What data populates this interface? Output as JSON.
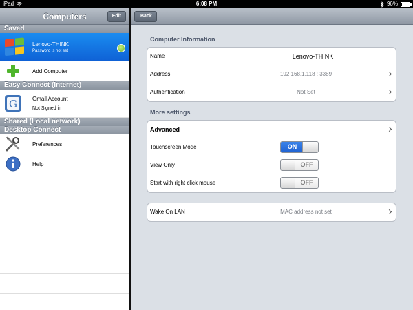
{
  "status": {
    "device": "iPad",
    "time": "6:08 PM",
    "battery": "96%",
    "battery_level": 0.96
  },
  "left": {
    "title": "Computers",
    "edit_label": "Edit",
    "sections": {
      "saved": "Saved",
      "easy_connect": "Easy Connect (Internet)",
      "shared": "Shared (Local network)",
      "desktop_connect": "Desktop Connect"
    },
    "saved_items": [
      {
        "name": "Lenovo-THINK",
        "sub": "Password is not set"
      }
    ],
    "add_computer": "Add Computer",
    "gmail": {
      "name": "Gmail Account",
      "sub": "Not Signed in"
    },
    "preferences": "Preferences",
    "help": "Help"
  },
  "right": {
    "back_label": "Back",
    "computer_info_title": "Computer Information",
    "info_rows": [
      {
        "label": "Name",
        "value": "Lenovo-THINK"
      },
      {
        "label": "Address",
        "value": "192.168.1.118 : 3389"
      },
      {
        "label": "Authentication",
        "value": "Not Set"
      }
    ],
    "more_settings_title": "More settings",
    "advanced_label": "Advanced",
    "toggles": [
      {
        "label": "Touchscreen Mode",
        "state": "ON"
      },
      {
        "label": "View Only",
        "state": "OFF"
      },
      {
        "label": "Start with right click mouse",
        "state": "OFF"
      }
    ],
    "wake_on_lan": {
      "label": "Wake On LAN",
      "value": "MAC address not set"
    }
  },
  "colors": {
    "selection": "#1a8cf0",
    "toggle_on": "#2f74e0",
    "panel_bg": "#dbe0e6"
  },
  "icons": [
    "wifi-icon",
    "bluetooth-icon",
    "battery-icon",
    "windows-logo-icon",
    "sync-status-icon",
    "add-icon",
    "google-icon",
    "tools-icon",
    "info-icon",
    "chevron-right-icon"
  ]
}
